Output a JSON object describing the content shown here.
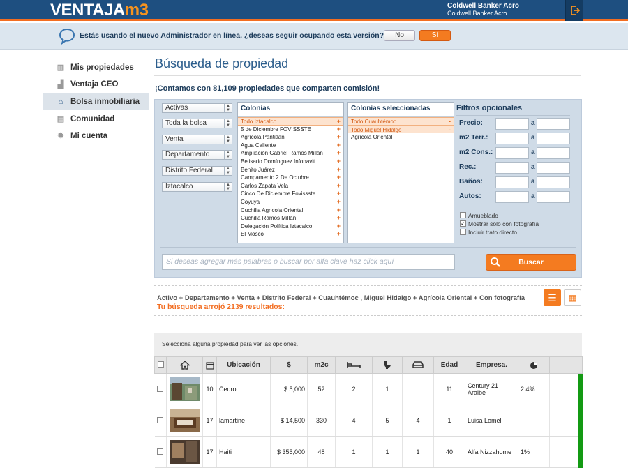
{
  "header": {
    "logo_main": "VENTAJA",
    "logo_accent": "m3",
    "brand_title": "Coldwell Banker Acro",
    "brand_sub": "Coldwell Banker Acro",
    "logout_icon": "logout-icon"
  },
  "notice": {
    "text": "Estás usando el nuevo Administrador en línea, ¿deseas seguir ocupando esta versión?",
    "no_label": "No",
    "si_label": "Sí"
  },
  "sidebar": {
    "items": [
      {
        "label": "Mis propiedades",
        "icon": "book-icon"
      },
      {
        "label": "Ventaja CEO",
        "icon": "bar-chart-icon"
      },
      {
        "label": "Bolsa inmobiliaria",
        "icon": "home-icon",
        "active": true
      },
      {
        "label": "Comunidad",
        "icon": "chat-icon"
      },
      {
        "label": "Mi cuenta",
        "icon": "gear-icon"
      }
    ]
  },
  "main": {
    "title": "Búsqueda de propiedad",
    "count_text": "¡Contamos con 81,109 propiedades que comparten comisión!"
  },
  "search": {
    "selects": [
      "Activas",
      "Toda la bolsa",
      "Venta",
      "Departamento",
      "Distrito Federal",
      "Iztacalco"
    ],
    "colonias_title": "Colonias",
    "colonias": [
      "Todo Iztacalco",
      "5 de Diciembre FOVISSSTE",
      "Agrícola Pantitlan",
      "Agua Caliente",
      "Ampliación Gabriel Ramos Millán",
      "Belisario Domínguez Infonavit",
      "Benito Juárez",
      "Campamento 2 De Octubre",
      "Carlos Zapata Vela",
      "Cinco De Diciembre Fovissste",
      "Coyuya",
      "Cuchilla Agricola Oriental",
      "Cuchilla Ramos Millán",
      "Delegación Política Iztacalco",
      "El Mosco"
    ],
    "seleccionadas_title": "Colonias seleccionadas",
    "seleccionadas": [
      "Todo Cuauhtémoc",
      "Todo Miguel Hidalgo",
      "Agrícola Oriental"
    ],
    "filters_title": "Filtros opcionales",
    "filters": [
      "Precio:",
      "m2 Terr.:",
      "m2 Cons.:",
      "Rec.:",
      "Baños:",
      "Autos:"
    ],
    "range_sep": "a",
    "checkboxes": [
      {
        "label": "Amueblado",
        "checked": false
      },
      {
        "label": "Mostrar solo con fotografía",
        "checked": true
      },
      {
        "label": "Incluir trato directo",
        "checked": false
      }
    ],
    "keyword_placeholder": "Si deseas agregar más palabras o buscar por alfa clave haz click aquí",
    "buscar_label": "Buscar"
  },
  "summary": {
    "criteria": "Activo + Departamento + Venta + Distrito Federal + Cuauhtémoc , Miguel Hidalgo + Agrícola Oriental + Con fotografía",
    "results": "Tu búsqueda arrojó 2139 resultados:"
  },
  "table": {
    "hint": "Selecciona alguna propiedad para ver las opciones.",
    "headers": [
      "Ubicación",
      "$",
      "m2c",
      "Edad",
      "Empresa."
    ],
    "rows": [
      {
        "days": "10",
        "ubicacion": "Cedro",
        "precio": "$ 5,000",
        "m2c": "52",
        "rec": "2",
        "banos": "1",
        "autos": "",
        "edad": "11",
        "empresa": "Century 21 Araibe",
        "comision": "2.4%"
      },
      {
        "days": "17",
        "ubicacion": "lamartine",
        "precio": "$ 14,500",
        "m2c": "330",
        "rec": "4",
        "banos": "5",
        "autos": "4",
        "edad": "1",
        "empresa": "Luisa Lomeli",
        "comision": ""
      },
      {
        "days": "17",
        "ubicacion": "Haiti",
        "precio": "$ 355,000",
        "m2c": "48",
        "rec": "1",
        "banos": "1",
        "autos": "1",
        "edad": "40",
        "empresa": "Alfa Nizzahome",
        "comision": "1%"
      }
    ]
  },
  "colors": {
    "header_bg": "#1e4f80",
    "accent": "#f47b20",
    "status_green": "#139a13"
  }
}
